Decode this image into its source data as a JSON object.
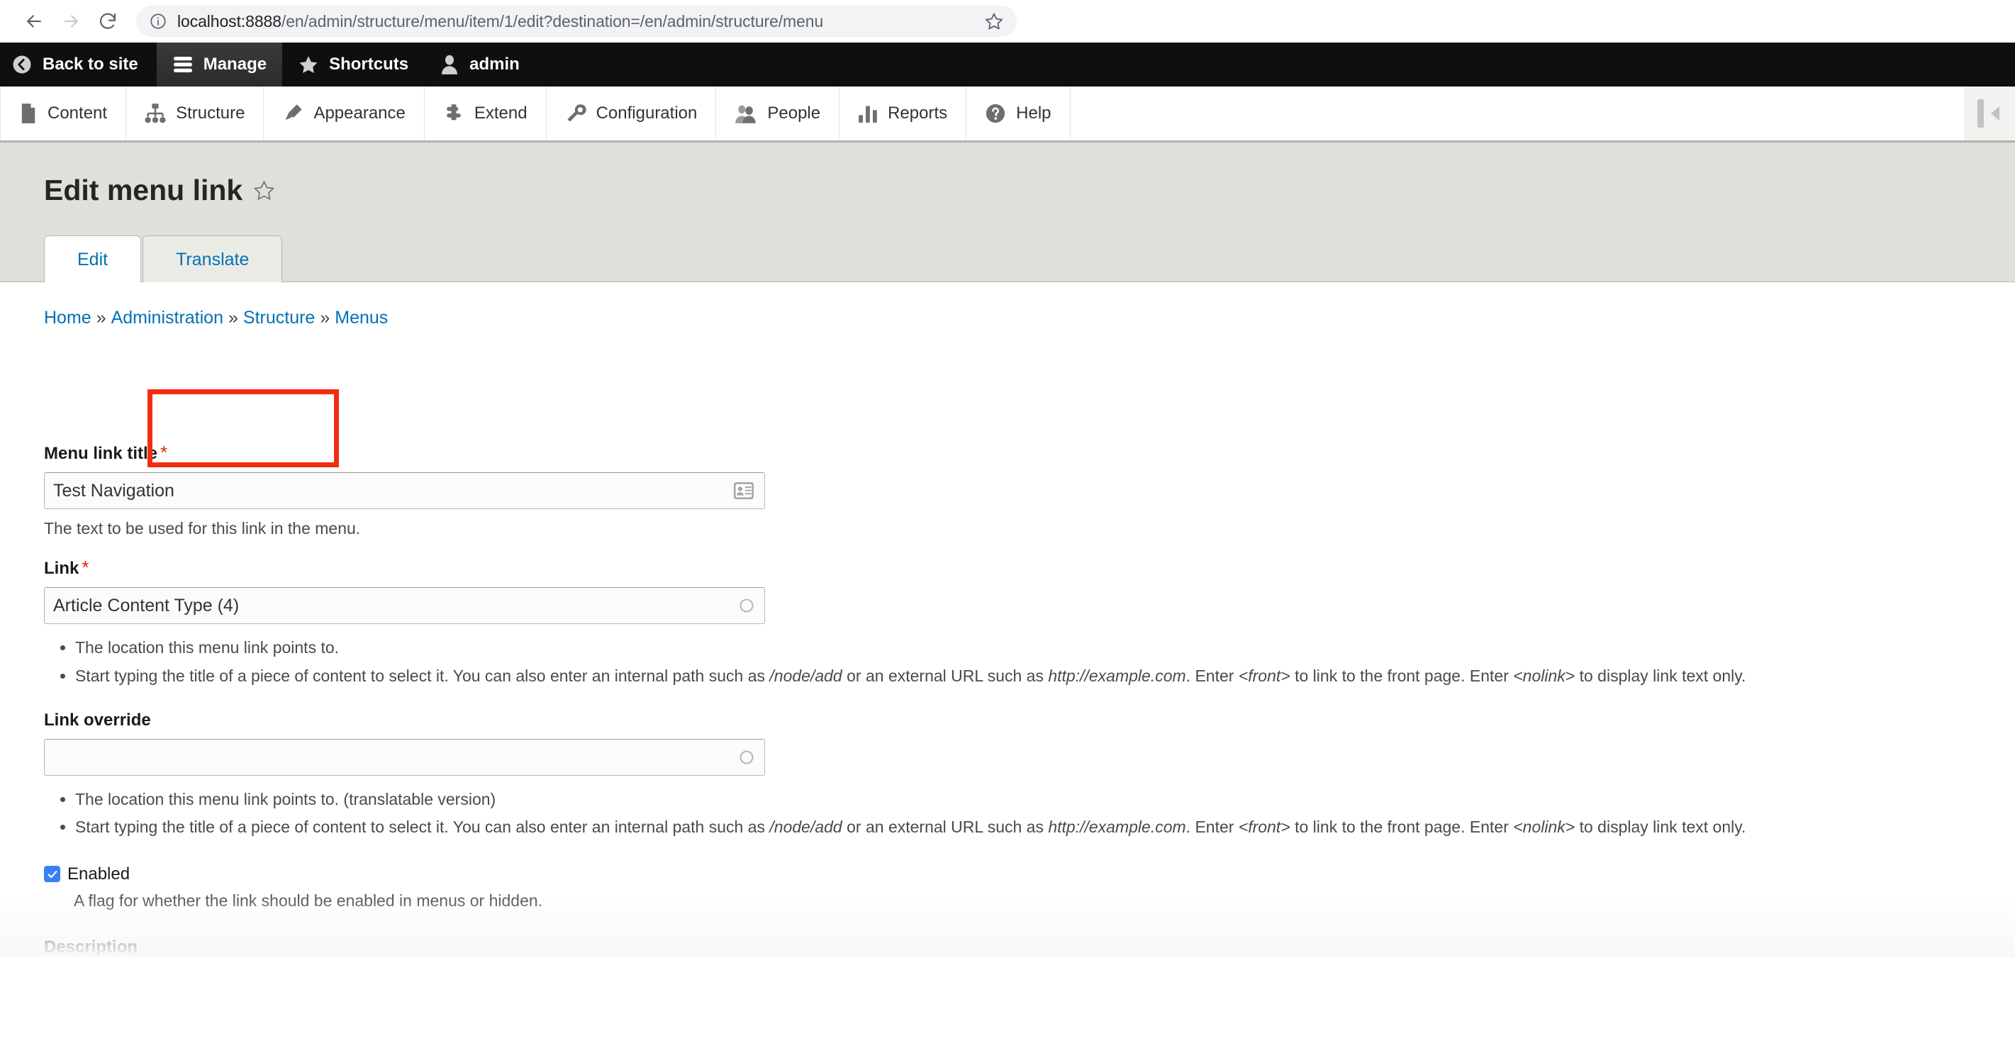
{
  "browser": {
    "url_host": "localhost:8888",
    "url_path": "/en/admin/structure/menu/item/1/edit?destination=/en/admin/structure/menu",
    "back_icon": "back-arrow-icon",
    "forward_icon": "forward-arrow-icon",
    "reload_icon": "reload-icon",
    "info_icon": "page-info-icon",
    "star_icon": "bookmark-star-icon"
  },
  "toolbar": {
    "items": [
      {
        "label": "Back to site",
        "icon": "back-circle-icon",
        "active": false
      },
      {
        "label": "Manage",
        "icon": "hamburger-icon",
        "active": true
      },
      {
        "label": "Shortcuts",
        "icon": "star-icon",
        "active": false
      },
      {
        "label": "admin",
        "icon": "user-icon",
        "active": false
      }
    ]
  },
  "admin_menu": {
    "items": [
      {
        "label": "Content",
        "icon": "content-page-icon"
      },
      {
        "label": "Structure",
        "icon": "structure-tree-icon"
      },
      {
        "label": "Appearance",
        "icon": "appearance-brush-icon"
      },
      {
        "label": "Extend",
        "icon": "extend-puzzle-icon"
      },
      {
        "label": "Configuration",
        "icon": "configuration-wrench-icon"
      },
      {
        "label": "People",
        "icon": "people-icon"
      },
      {
        "label": "Reports",
        "icon": "reports-bars-icon"
      },
      {
        "label": "Help",
        "icon": "help-question-icon"
      }
    ],
    "toggle_icon": "orientation-toggle-icon"
  },
  "page": {
    "title": "Edit menu link",
    "title_star_icon": "favorite-star-outline-icon",
    "tabs": [
      {
        "label": "Edit",
        "active": true
      },
      {
        "label": "Translate",
        "active": false,
        "highlighted": true
      }
    ],
    "highlight_color": "#f22d12"
  },
  "breadcrumb": {
    "separator": "»",
    "items": [
      {
        "label": "Home"
      },
      {
        "label": "Administration"
      },
      {
        "label": "Structure"
      },
      {
        "label": "Menus"
      }
    ]
  },
  "form": {
    "menu_link_title": {
      "label": "Menu link title",
      "required_marker": "*",
      "value": "Test Navigation",
      "adorn_icon": "contact-card-autofill-icon",
      "description": "The text to be used for this link in the menu."
    },
    "link": {
      "label": "Link",
      "required_marker": "*",
      "value": "Article Content Type (4)",
      "adorn_icon": "autocomplete-throbber-icon",
      "descriptions": [
        "The location this menu link points to.",
        "Start typing the title of a piece of content to select it. You can also enter an internal path such as /node/add or an external URL such as http://example.com. Enter <front> to link to the front page. Enter <nolink> to display link text only."
      ],
      "desc2_parts": {
        "a": "Start typing the title of a piece of content to select it. You can also enter an internal path such as ",
        "em1": "/node/add",
        "b": " or an external URL such as ",
        "em2": "http://example.com",
        "c": ". Enter ",
        "em3": "<front>",
        "d": " to link to the front page. Enter ",
        "em4": "<nolink>",
        "e": " to display link text only."
      }
    },
    "link_override": {
      "label": "Link override",
      "value": "",
      "placeholder": "",
      "adorn_icon": "autocomplete-throbber-icon",
      "descriptions": [
        "The location this menu link points to. (translatable version)",
        "Start typing the title of a piece of content to select it. You can also enter an internal path such as /node/add or an external URL such as http://example.com. Enter <front> to link to the front page. Enter <nolink> to display link text only."
      ]
    },
    "enabled": {
      "label": "Enabled",
      "checked": true,
      "description": "A flag for whether the link should be enabled in menus or hidden."
    },
    "description_field": {
      "label": "Description"
    }
  }
}
